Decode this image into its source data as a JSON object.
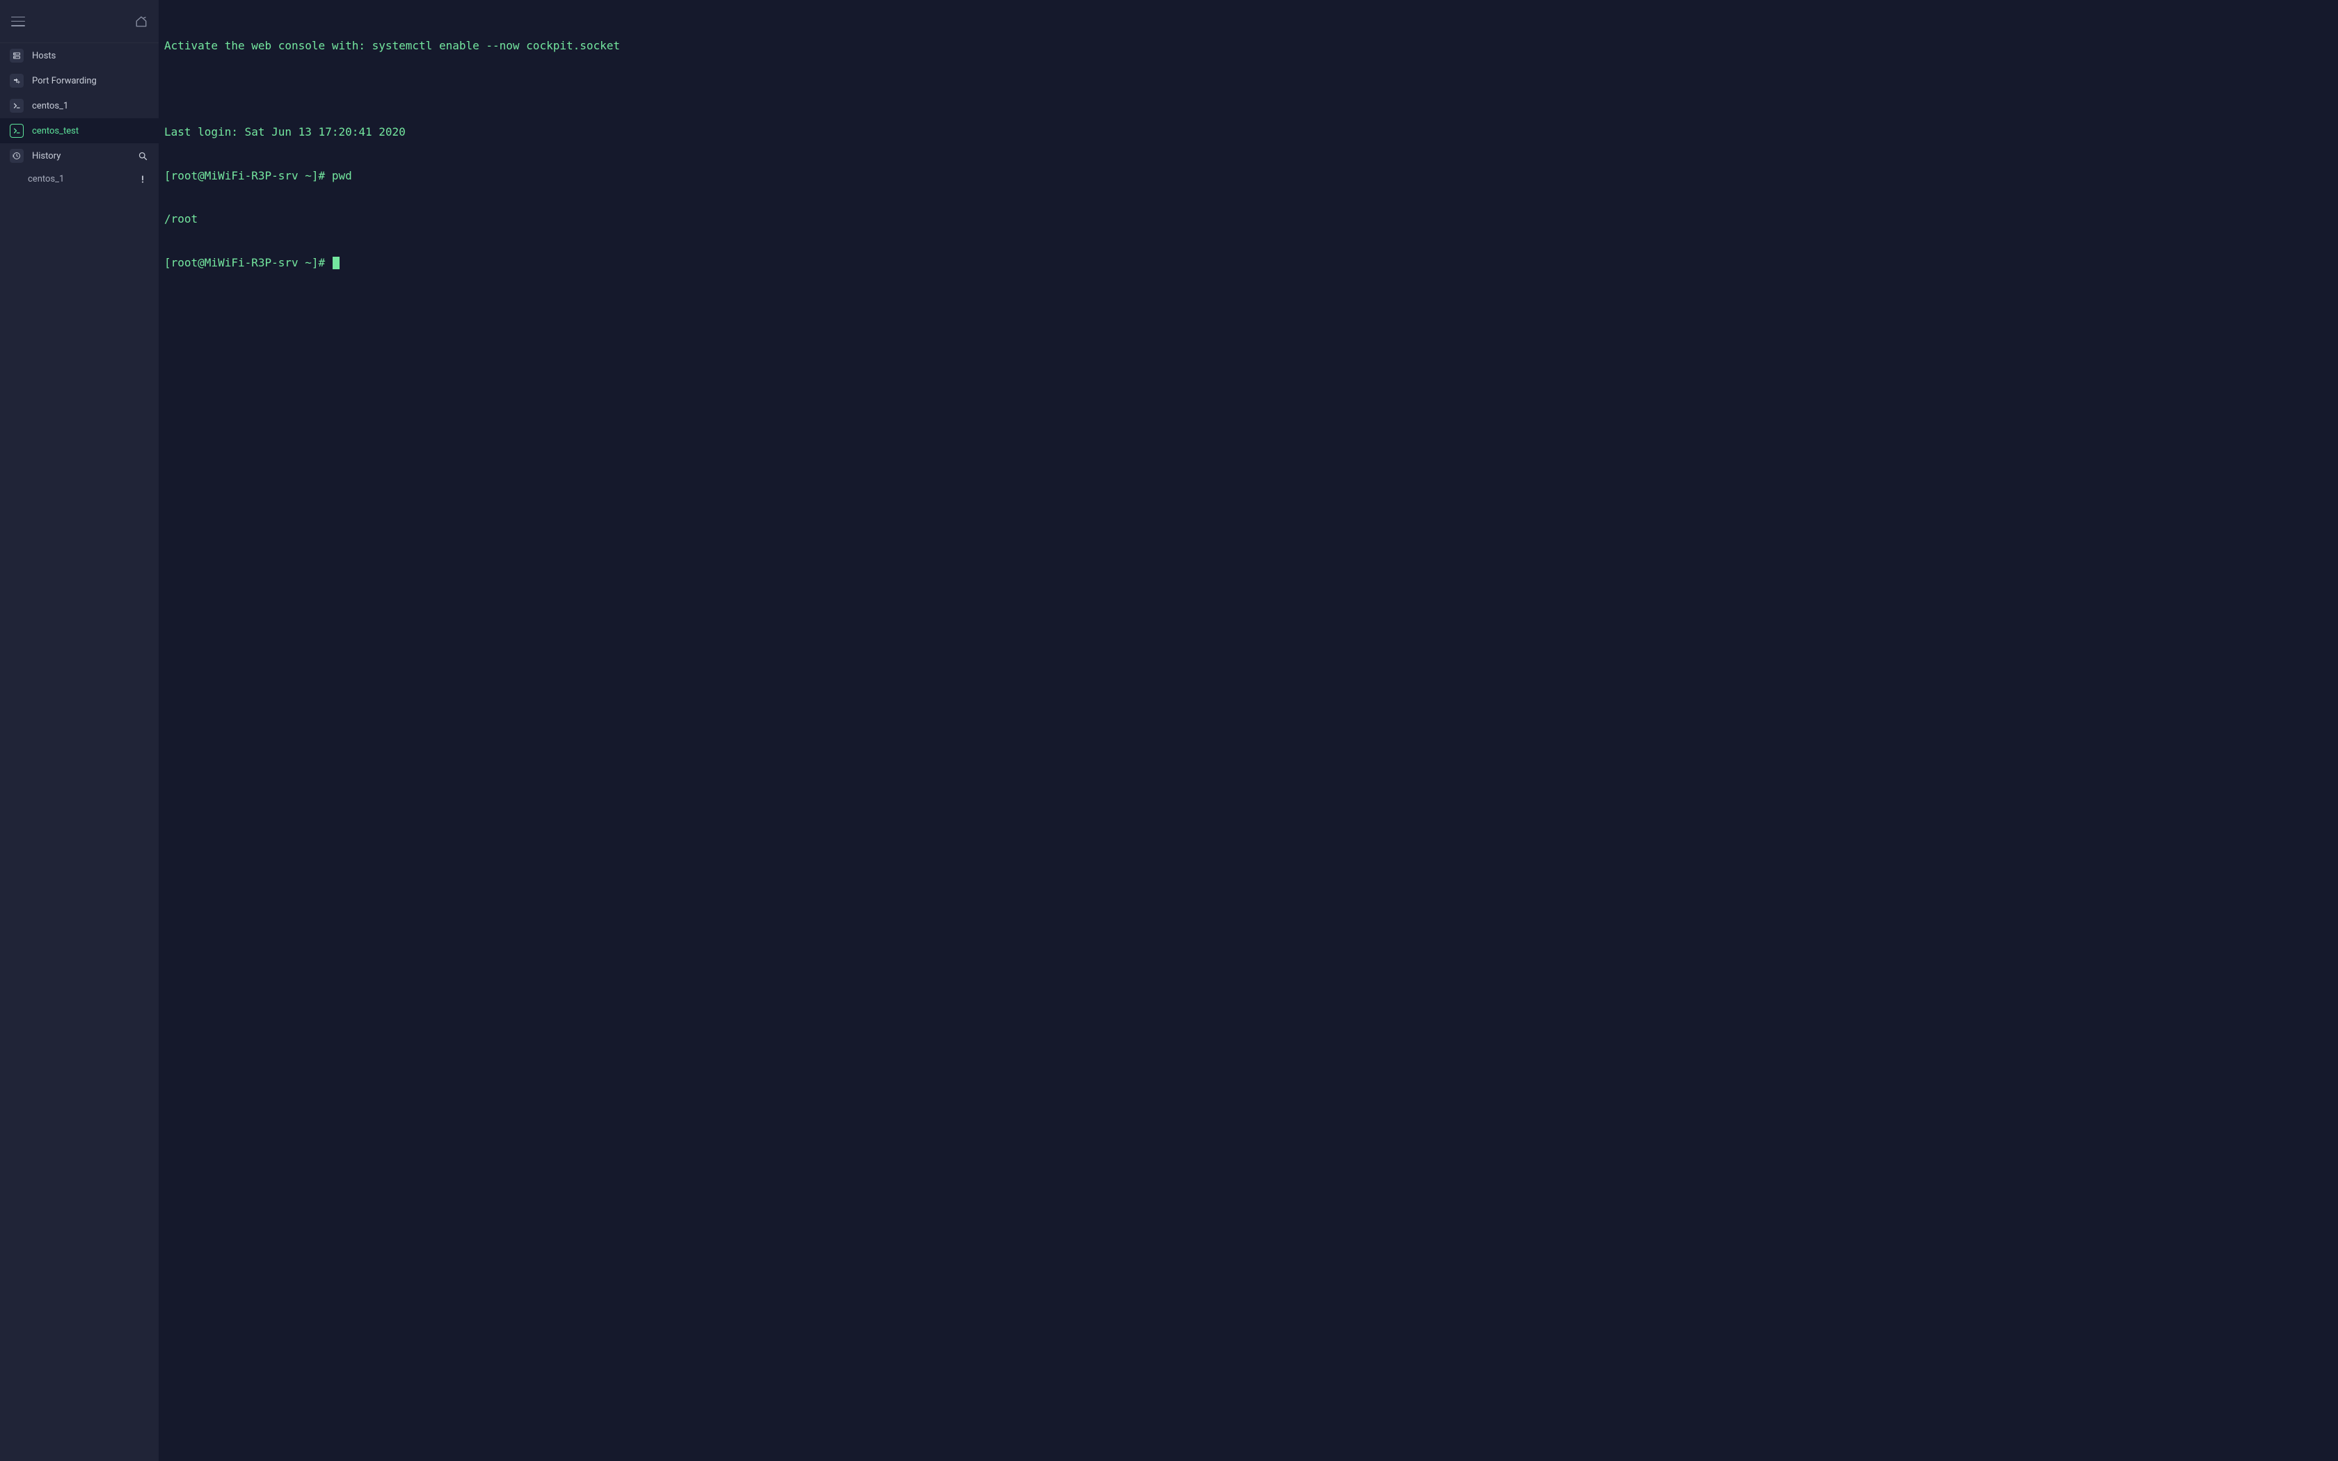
{
  "sidebar": {
    "items": [
      {
        "icon": "server-icon",
        "label": "Hosts"
      },
      {
        "icon": "forward-icon",
        "label": "Port Forwarding"
      },
      {
        "icon": "terminal-icon",
        "label": "centos_1"
      },
      {
        "icon": "terminal-icon",
        "label": "centos_test",
        "selected": true,
        "accent": true
      }
    ],
    "history": {
      "label": "History",
      "children": [
        {
          "label": "centos_1"
        }
      ]
    }
  },
  "terminal": {
    "lines": [
      "Activate the web console with: systemctl enable --now cockpit.socket",
      "",
      "Last login: Sat Jun 13 17:20:41 2020",
      "[root@MiWiFi-R3P-srv ~]# pwd",
      "/root"
    ],
    "prompt": "[root@MiWiFi-R3P-srv ~]# "
  },
  "colors": {
    "background": "#15192c",
    "sidebar": "#202437",
    "terminal_text": "#74e79f",
    "accent": "#5de29a"
  }
}
